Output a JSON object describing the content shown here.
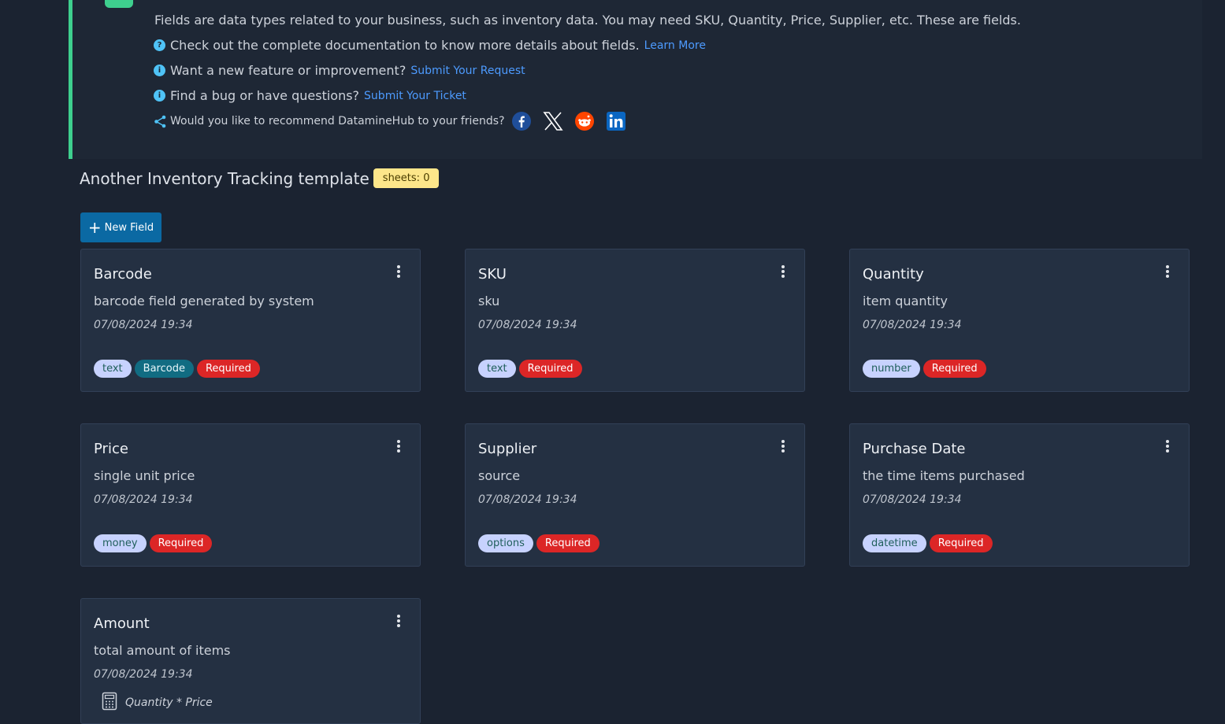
{
  "info": {
    "intro": "Fields are data types related to your business, such as inventory data. You may need SKU, Quantity, Price, Supplier, etc. These are fields.",
    "docs_text": "Check out the complete documentation to know more details about fields.",
    "docs_link": "Learn More",
    "feature_text": "Want a new feature or improvement?",
    "feature_link": "Submit Your Request",
    "bug_text": "Find a bug or have questions?",
    "bug_link": "Submit Your Ticket",
    "share_text": "Would you like to recommend DatamineHub to your friends?",
    "social_icons": [
      "facebook-icon",
      "x-icon",
      "reddit-icon",
      "linkedin-icon"
    ]
  },
  "page": {
    "title": "Another Inventory Tracking template",
    "sheets_badge": "sheets: 0",
    "new_field_label": "New Field"
  },
  "fields": [
    {
      "name": "Barcode",
      "desc": "barcode field generated by system",
      "date": "07/08/2024 19:34",
      "type": "text",
      "extra": "Barcode",
      "required": "Required"
    },
    {
      "name": "SKU",
      "desc": "sku",
      "date": "07/08/2024 19:34",
      "type": "text",
      "required": "Required"
    },
    {
      "name": "Quantity",
      "desc": "item quantity",
      "date": "07/08/2024 19:34",
      "type": "number",
      "required": "Required"
    },
    {
      "name": "Price",
      "desc": "single unit price",
      "date": "07/08/2024 19:34",
      "type": "money",
      "required": "Required"
    },
    {
      "name": "Supplier",
      "desc": "source",
      "date": "07/08/2024 19:34",
      "type": "options",
      "required": "Required"
    },
    {
      "name": "Purchase Date",
      "desc": "the time items purchased",
      "date": "07/08/2024 19:34",
      "type": "datetime",
      "required": "Required"
    },
    {
      "name": "Amount",
      "desc": "total amount of items",
      "date": "07/08/2024 19:34",
      "formula": "Quantity * Price"
    }
  ],
  "colors": {
    "accent_green": "#3ecf8e",
    "link_blue": "#4d9bff",
    "required_red": "#dc2626",
    "type_tag": "#c7d2fe",
    "button_blue": "#0b69a3"
  }
}
